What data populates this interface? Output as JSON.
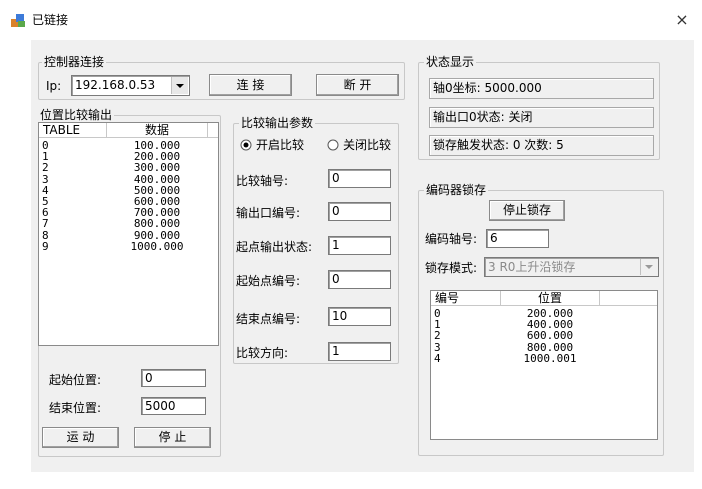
{
  "window": {
    "title": "已链接",
    "close": "×"
  },
  "controller": {
    "legend": "控制器连接",
    "ip_label": "Ip:",
    "ip_value": "192.168.0.53",
    "connect": "连 接",
    "disconnect": "断 开"
  },
  "position_compare": {
    "legend": "位置比较输出",
    "columns": [
      "TABLE",
      "数据"
    ],
    "rows": [
      [
        "0",
        "100.000"
      ],
      [
        "1",
        "200.000"
      ],
      [
        "2",
        "300.000"
      ],
      [
        "3",
        "400.000"
      ],
      [
        "4",
        "500.000"
      ],
      [
        "5",
        "600.000"
      ],
      [
        "6",
        "700.000"
      ],
      [
        "7",
        "800.000"
      ],
      [
        "8",
        "900.000"
      ],
      [
        "9",
        "1000.000"
      ]
    ],
    "start_label": "起始位置:",
    "start_value": "0",
    "end_label": "结束位置:",
    "end_value": "5000",
    "run": "运 动",
    "stop": "停 止"
  },
  "compare_params": {
    "legend": "比较输出参数",
    "open": "开启比较",
    "close": "关闭比较",
    "open_selected": true,
    "axis_label": "比较轴号:",
    "axis_value": "0",
    "output_label": "输出口编号:",
    "output_value": "0",
    "start_state_label": "起点输出状态:",
    "start_state_value": "1",
    "start_point_label": "起始点编号:",
    "start_point_value": "0",
    "end_point_label": "结束点编号:",
    "end_point_value": "10",
    "direction_label": "比较方向:",
    "direction_value": "1"
  },
  "status": {
    "legend": "状态显示",
    "axis0": "轴0坐标: 5000.000",
    "output0": "输出口0状态: 关闭",
    "latch": "锁存触发状态: 0 次数: 5"
  },
  "encoder": {
    "legend": "编码器锁存",
    "stop_latch": "停止锁存",
    "axis_label": "编码轴号:",
    "axis_value": "6",
    "mode_label": "锁存模式:",
    "mode_value": "3 R0上升沿锁存",
    "columns": [
      "编号",
      "位置"
    ],
    "rows": [
      [
        "0",
        "200.000"
      ],
      [
        "1",
        "400.000"
      ],
      [
        "2",
        "600.000"
      ],
      [
        "3",
        "800.000"
      ],
      [
        "4",
        "1000.001"
      ]
    ]
  }
}
